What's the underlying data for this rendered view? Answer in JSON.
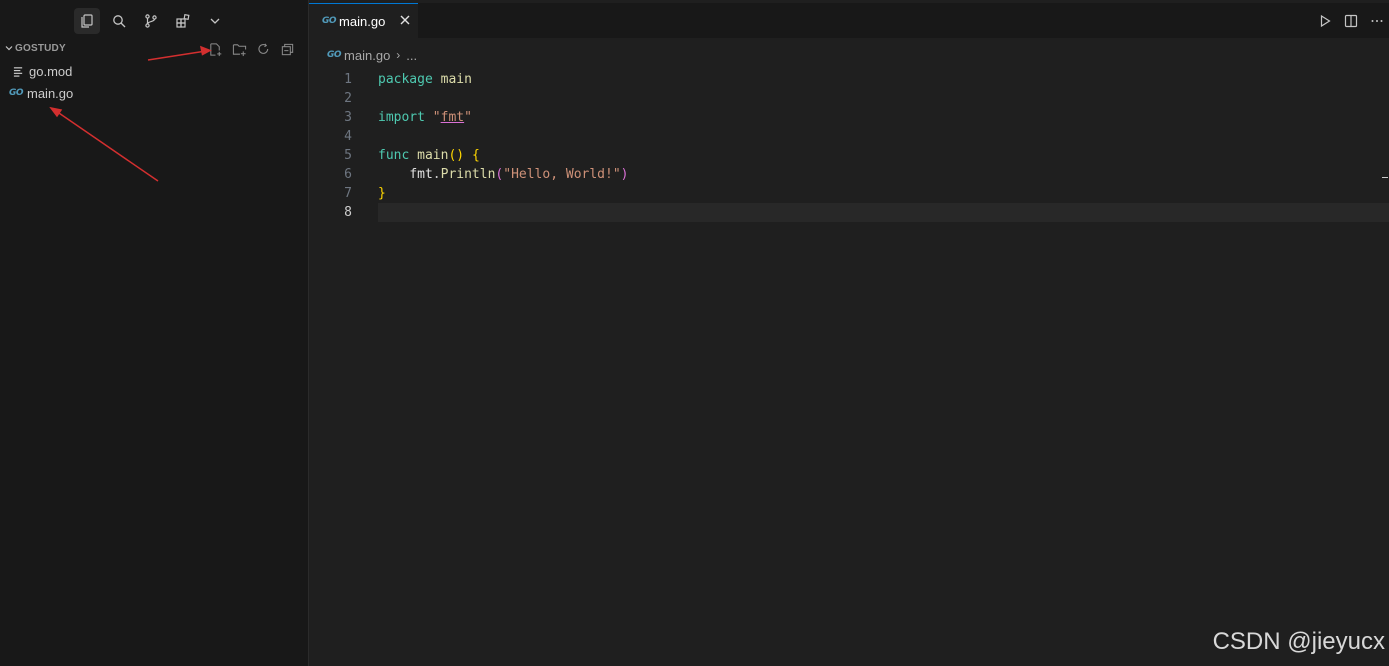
{
  "sidebar": {
    "tabs": [
      {
        "name": "explorer-icon",
        "active": true
      },
      {
        "name": "search-icon"
      },
      {
        "name": "source-control-icon"
      },
      {
        "name": "extensions-icon"
      },
      {
        "name": "chevron-down-icon"
      }
    ],
    "explorer": {
      "title": "GOSTUDY",
      "actions": [
        "new-file-icon",
        "new-folder-icon",
        "refresh-icon",
        "collapse-all-icon"
      ],
      "files": [
        {
          "name": "go.mod",
          "icon": "lines-icon"
        },
        {
          "name": "main.go",
          "icon": "go-file-icon",
          "badge": "GO"
        }
      ]
    }
  },
  "editor": {
    "tab": {
      "label": "main.go",
      "badge": "GO"
    },
    "breadcrumb": {
      "file": "main.go",
      "tail": "..."
    },
    "actions": [
      "run-icon",
      "split-editor-icon",
      "more-actions-icon"
    ],
    "lines": [
      {
        "n": "1",
        "text": "package main"
      },
      {
        "n": "2",
        "text": ""
      },
      {
        "n": "3",
        "text": "import \"fmt\""
      },
      {
        "n": "4",
        "text": ""
      },
      {
        "n": "5",
        "text": "func main() {"
      },
      {
        "n": "6",
        "text": "    fmt.Println(\"Hello, World!\")"
      },
      {
        "n": "7",
        "text": "}"
      },
      {
        "n": "8",
        "text": ""
      }
    ],
    "current_line": "8"
  },
  "colors": {
    "accent": "#0078d4",
    "go_badge": "#519aba",
    "arrow": "#d32f2f"
  },
  "watermark": "CSDN @jieyucx"
}
